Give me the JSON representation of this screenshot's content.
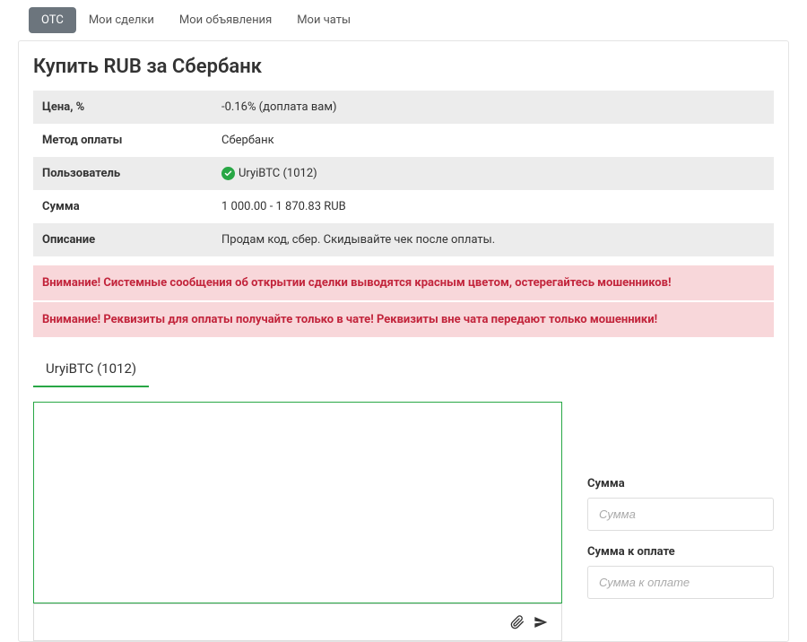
{
  "tabs": {
    "otc": "OTC",
    "trades": "Мои сделки",
    "ads": "Мои объявления",
    "chats": "Мои чаты"
  },
  "title": "Купить RUB за Сбербанк",
  "info": {
    "price_label": "Цена, %",
    "price_value": "-0.16% (доплата вам)",
    "method_label": "Метод оплаты",
    "method_value": "Сбербанк",
    "user_label": "Пользователь",
    "user_value": "UryiBTC (1012)",
    "sum_label": "Сумма",
    "sum_value": "1 000.00 - 1 870.83 RUB",
    "desc_label": "Описание",
    "desc_value": "Продам код, сбер. Скидывайте чек после оплаты."
  },
  "alerts": {
    "a1": "Внимание! Системные сообщения об открытии сделки выводятся красным цветом, остерегайтесь мошенников!",
    "a2": "Внимание! Реквизиты для оплаты получайте только в чате! Реквизиты вне чата передают только мошенники!"
  },
  "chat_tab": "UryiBTC (1012)",
  "chat_input_placeholder": "",
  "form": {
    "sum_label": "Сумма",
    "sum_placeholder": "Сумма",
    "pay_label": "Сумма к оплате",
    "pay_placeholder": "Сумма к оплате"
  }
}
